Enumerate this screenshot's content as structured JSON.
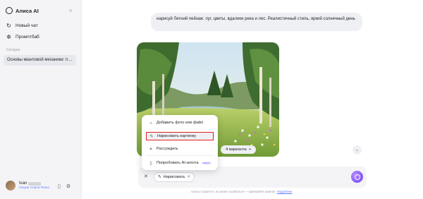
{
  "sidebar": {
    "brand": "Алиса AI",
    "new_chat": "Новый чат",
    "prompt_book": "Промптбаб",
    "section_label": "Сегодня",
    "history": [
      "Основы квантовой механики: пр..."
    ],
    "user_name": "Ivan",
    "user_plan": "Опция Алиса Плюс"
  },
  "chat": {
    "user_message": "нарисуй Летний пейзаж: луг, цветы, вдалеке река и лес. Реалистичный стиль, яркий солнечный день",
    "variants_label": "4 варианта",
    "variants_icon": "+"
  },
  "menu": {
    "items": [
      {
        "label": "Добавить фото или файл",
        "icon": "paperclip-icon"
      },
      {
        "label": "Нарисовать картинку",
        "icon": "brush-icon"
      },
      {
        "label": "Рассуждать",
        "icon": "bulb-icon"
      },
      {
        "label": "Попробовать AI-агента",
        "icon": "agent-icon",
        "badge": "скоро"
      }
    ]
  },
  "composer": {
    "chip_label": "Нарисовать",
    "disclaimer_text": "Алиса старается, но может ошибаться — проверяйте важное.",
    "disclaimer_link": "Подробнее"
  },
  "colors": {
    "accent": "#6a3ef5",
    "highlight_border": "#e02020",
    "link": "#5c7cfa"
  }
}
